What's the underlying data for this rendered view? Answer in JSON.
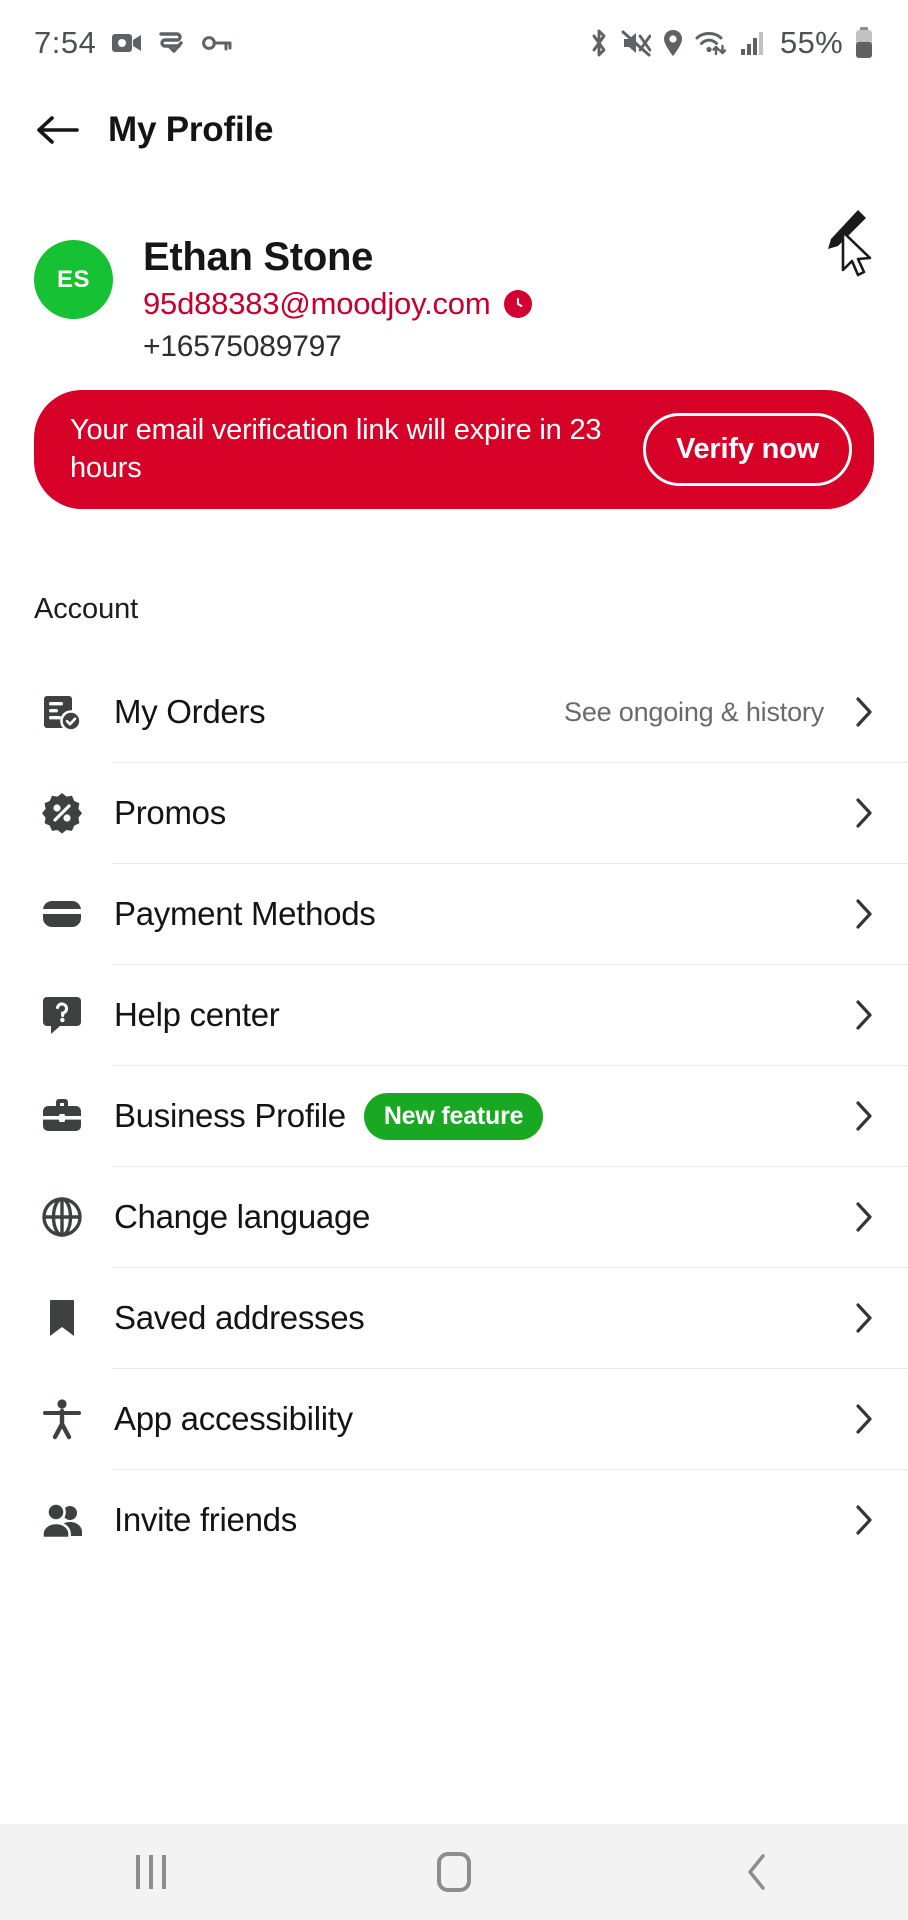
{
  "status_bar": {
    "time": "7:54",
    "battery_percent": "55%",
    "left_icons": [
      "video-camera-icon",
      "screen-record-icon",
      "vpn-key-icon"
    ],
    "right_icons": [
      "bluetooth-icon",
      "mute-icon",
      "location-icon",
      "wifi-icon",
      "signal-icon",
      "battery-icon"
    ]
  },
  "app_bar": {
    "back_icon": "back-arrow-icon",
    "title": "My Profile"
  },
  "profile": {
    "avatar_initials": "ES",
    "avatar_color": "#16c233",
    "name": "Ethan Stone",
    "email": "95d88383@moodjoy.com",
    "email_color": "#c6002d",
    "pending_badge_icon": "clock-icon",
    "phone": "+16575089797",
    "edit_icon": "pencil-icon"
  },
  "banner": {
    "message": "Your email verification link will expire in 23 hours",
    "action_label": "Verify now",
    "background_color": "#d70026"
  },
  "account_section": {
    "title": "Account",
    "items": [
      {
        "label": "My Orders",
        "icon": "orders-receipt-icon",
        "hint": "See ongoing & history",
        "badge": ""
      },
      {
        "label": "Promos",
        "icon": "discount-badge-icon",
        "hint": "",
        "badge": ""
      },
      {
        "label": "Payment Methods",
        "icon": "credit-card-icon",
        "hint": "",
        "badge": ""
      },
      {
        "label": "Help center",
        "icon": "question-bubble-icon",
        "hint": "",
        "badge": ""
      },
      {
        "label": "Business Profile",
        "icon": "briefcase-icon",
        "hint": "",
        "badge": "New feature"
      },
      {
        "label": "Change language",
        "icon": "globe-icon",
        "hint": "",
        "badge": ""
      },
      {
        "label": "Saved addresses",
        "icon": "bookmark-icon",
        "hint": "",
        "badge": ""
      },
      {
        "label": "App accessibility",
        "icon": "accessibility-icon",
        "hint": "",
        "badge": ""
      },
      {
        "label": "Invite friends",
        "icon": "people-icon",
        "hint": "",
        "badge": ""
      }
    ],
    "badge_color": "#18a821",
    "chevron_icon": "chevron-right-icon"
  },
  "nav_bar": {
    "recents_icon": "recents-icon",
    "home_icon": "home-icon",
    "back_icon": "nav-back-icon"
  }
}
